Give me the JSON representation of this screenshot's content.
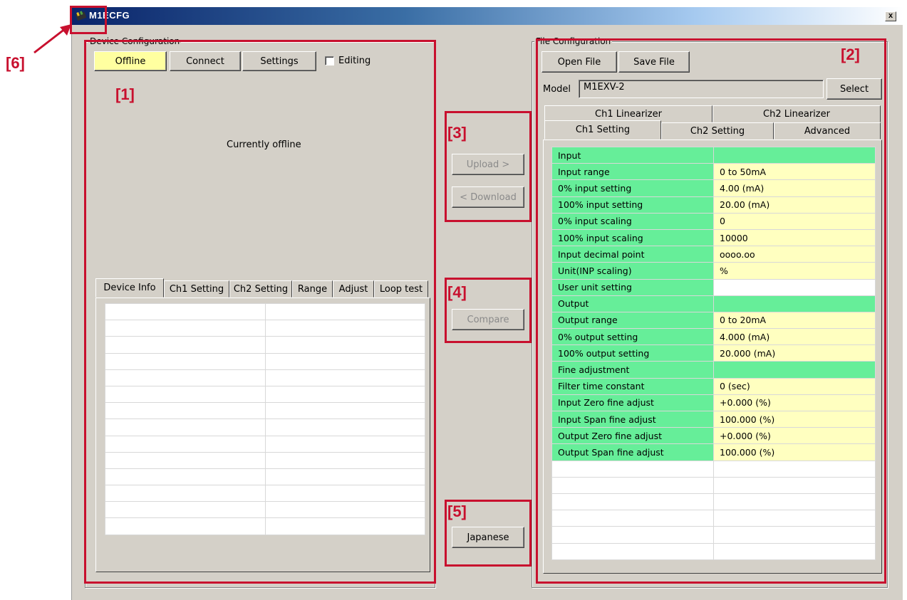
{
  "window": {
    "title": "M1ECFG",
    "close_label": "x"
  },
  "device": {
    "group_label": "Device Configuration",
    "offline_label": "Offline",
    "connect_label": "Connect",
    "settings_label": "Settings",
    "editing_label": "Editing",
    "status_text": "Currently offline",
    "tabs": [
      "Device Info",
      "Ch1 Setting",
      "Ch2 Setting",
      "Range",
      "Adjust",
      "Loop test"
    ],
    "active_tab": "Device Info"
  },
  "transfer": {
    "upload_label": "Upload >",
    "download_label": "< Download",
    "compare_label": "Compare",
    "language_label": "Japanese"
  },
  "file": {
    "group_label": "File Configuration",
    "open_label": "Open File",
    "save_label": "Save File",
    "model_label": "Model",
    "model_value": "M1EXV-2",
    "select_label": "Select",
    "tabs_top": [
      "Ch1 Linearizer",
      "Ch2 Linearizer"
    ],
    "tabs_bottom": [
      "Ch1 Setting",
      "Ch2 Setting",
      "Advanced"
    ],
    "active_tab": "Ch1 Setting",
    "rows": [
      {
        "label": "Input",
        "value": "",
        "kind": "section"
      },
      {
        "label": "Input range",
        "value": "0 to 50mA",
        "kind": "value"
      },
      {
        "label": "0% input setting",
        "value": "4.00 (mA)",
        "kind": "value"
      },
      {
        "label": "100% input setting",
        "value": "20.00 (mA)",
        "kind": "value"
      },
      {
        "label": "0% input scaling",
        "value": "0",
        "kind": "value"
      },
      {
        "label": "100% input scaling",
        "value": "10000",
        "kind": "value"
      },
      {
        "label": "Input decimal point",
        "value": "oooo.oo",
        "kind": "value"
      },
      {
        "label": "Unit(INP scaling)",
        "value": "%",
        "kind": "value"
      },
      {
        "label": "User unit setting",
        "value": "",
        "kind": "white"
      },
      {
        "label": "Output",
        "value": "",
        "kind": "section"
      },
      {
        "label": "Output range",
        "value": "0 to 20mA",
        "kind": "value"
      },
      {
        "label": "0% output setting",
        "value": "4.000 (mA)",
        "kind": "value"
      },
      {
        "label": "100% output setting",
        "value": "20.000 (mA)",
        "kind": "value"
      },
      {
        "label": "Fine adjustment",
        "value": "",
        "kind": "section"
      },
      {
        "label": "Filter time constant",
        "value": "0 (sec)",
        "kind": "value"
      },
      {
        "label": "Input Zero fine adjust",
        "value": "+0.000 (%)",
        "kind": "value"
      },
      {
        "label": "Input Span fine adjust",
        "value": "100.000 (%)",
        "kind": "value"
      },
      {
        "label": "Output Zero fine adjust",
        "value": "+0.000 (%)",
        "kind": "value"
      },
      {
        "label": "Output Span fine adjust",
        "value": "100.000 (%)",
        "kind": "value"
      }
    ]
  },
  "callouts": [
    "[1]",
    "[2]",
    "[3]",
    "[4]",
    "[5]",
    "[6]"
  ],
  "colors": {
    "callout": "#c8102e",
    "param_label_bg": "#66ee99",
    "param_value_bg": "#ffffc0",
    "offline_bg": "#ffffa0"
  }
}
